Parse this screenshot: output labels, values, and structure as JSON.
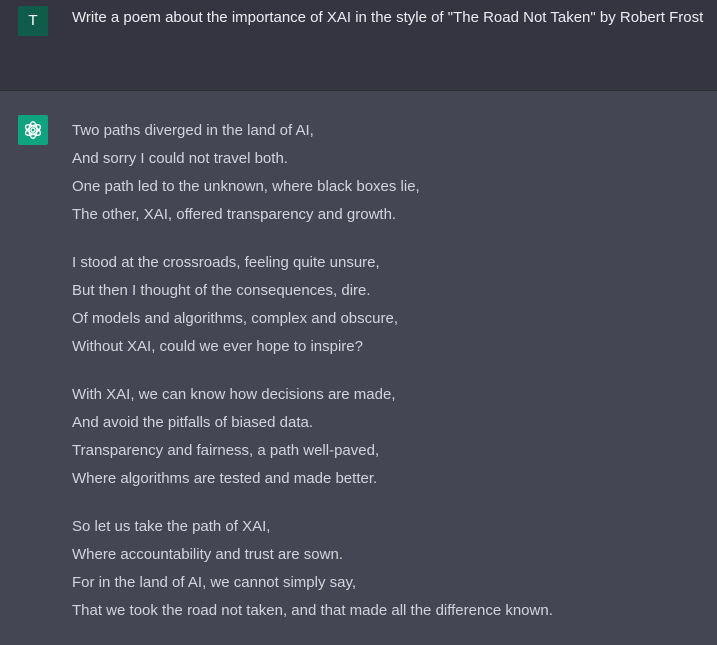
{
  "user": {
    "avatar_initial": "T",
    "message": "Write a poem about the importance of XAI in the style of \"The Road Not Taken\" by Robert Frost"
  },
  "assistant": {
    "avatar_icon": "openai-logo-icon",
    "stanzas": [
      [
        "Two paths diverged in the land of AI,",
        "And sorry I could not travel both.",
        "One path led to the unknown, where black boxes lie,",
        "The other, XAI, offered transparency and growth."
      ],
      [
        "I stood at the crossroads, feeling quite unsure,",
        "But then I thought of the consequences, dire.",
        "Of models and algorithms, complex and obscure,",
        "Without XAI, could we ever hope to inspire?"
      ],
      [
        "With XAI, we can know how decisions are made,",
        "And avoid the pitfalls of biased data.",
        "Transparency and fairness, a path well-paved,",
        "Where algorithms are tested and made better."
      ],
      [
        "So let us take the path of XAI,",
        "Where accountability and trust are sown.",
        "For in the land of AI, we cannot simply say,",
        "That we took the road not taken, and that made all the difference known."
      ]
    ]
  },
  "colors": {
    "user_bg": "#343541",
    "assistant_bg": "#444654",
    "user_avatar": "#0f5c4b",
    "assistant_avatar": "#10a37f",
    "text": "#d1d5db"
  }
}
